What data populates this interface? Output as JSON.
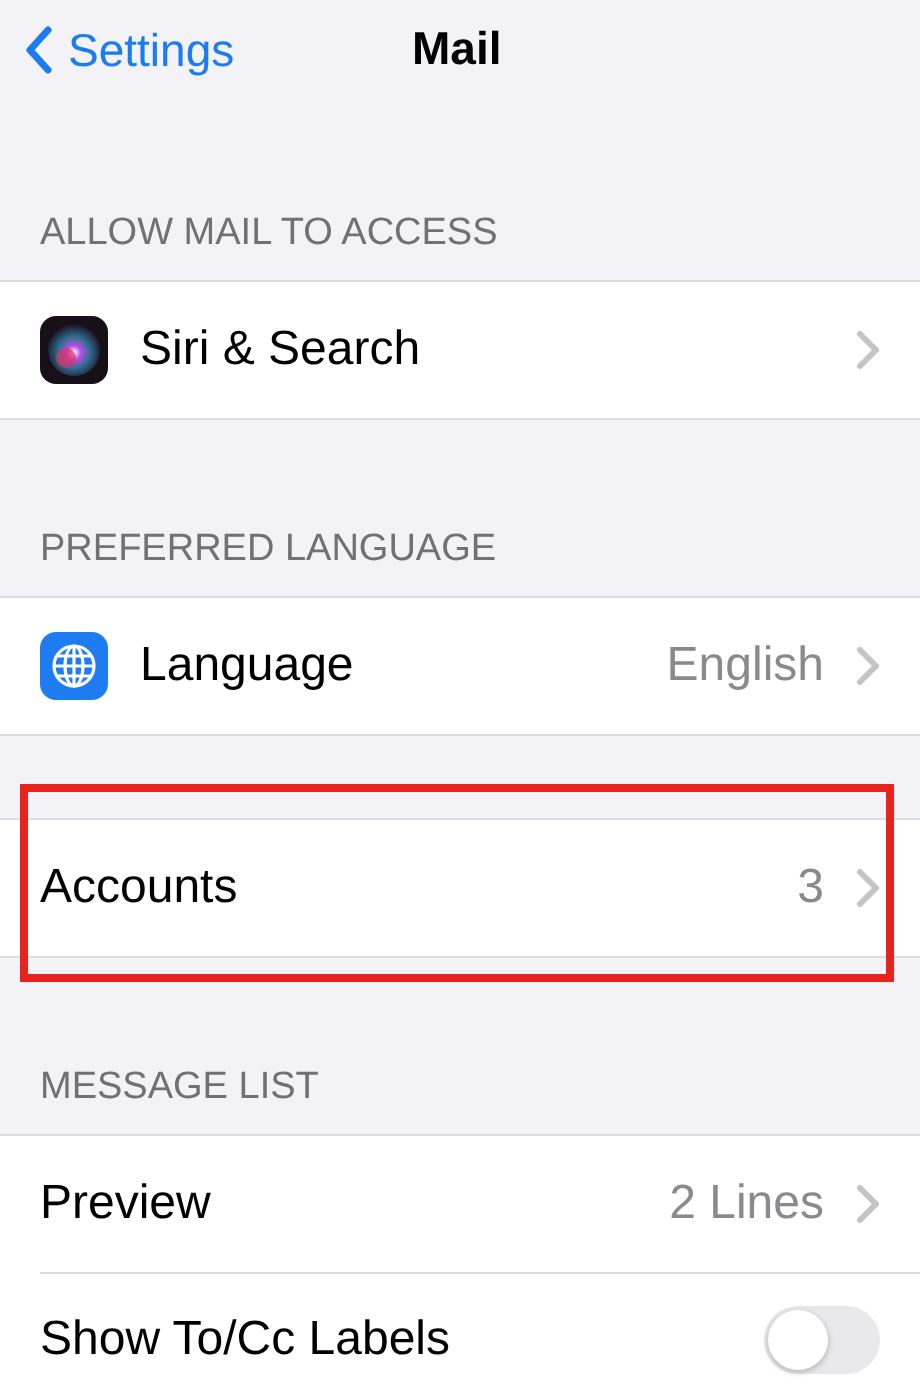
{
  "nav": {
    "back": "Settings",
    "title": "Mail"
  },
  "sections": [
    {
      "header": "ALLOW MAIL TO ACCESS",
      "highlighted": false,
      "rows": [
        {
          "kind": "siri",
          "label": "Siri & Search"
        }
      ]
    },
    {
      "header": "PREFERRED LANGUAGE",
      "highlighted": false,
      "rows": [
        {
          "kind": "globe",
          "label": "Language",
          "value": "English"
        }
      ]
    },
    {
      "highlighted": true,
      "rows": [
        {
          "kind": "link",
          "label": "Accounts",
          "value": "3"
        }
      ]
    },
    {
      "header": "MESSAGE LIST",
      "highlighted": false,
      "rows": [
        {
          "kind": "link",
          "label": "Preview",
          "value": "2 Lines"
        },
        {
          "kind": "toggle",
          "label": "Show To/Cc Labels",
          "on": false
        }
      ]
    }
  ]
}
